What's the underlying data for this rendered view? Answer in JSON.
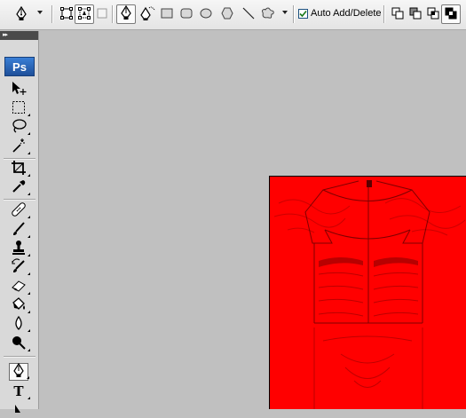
{
  "options_bar": {
    "current_tool_icon": "pen-tool-icon",
    "mode_buttons": [
      "shape-layers-icon",
      "paths-icon",
      "fill-pixels-icon"
    ],
    "tool_buttons": [
      "pen-icon",
      "freeform-pen-icon",
      "rectangle-icon",
      "rounded-rectangle-icon",
      "ellipse-icon",
      "polygon-icon",
      "line-icon",
      "custom-shape-icon"
    ],
    "auto_add_delete": {
      "label": "Auto Add/Delete",
      "checked": true
    },
    "path_ops": [
      "add-to-path-icon",
      "subtract-from-path-icon",
      "intersect-path-icon",
      "exclude-path-icon"
    ]
  },
  "toolbox": {
    "logo": "Ps",
    "tools": [
      "move-tool-icon",
      "marquee-tool-icon",
      "lasso-tool-icon",
      "magic-wand-tool-icon",
      "crop-tool-icon",
      "eyedropper-tool-icon",
      "healing-brush-tool-icon",
      "brush-tool-icon",
      "clone-stamp-tool-icon",
      "history-brush-tool-icon",
      "eraser-tool-icon",
      "paint-bucket-tool-icon",
      "blur-tool-icon",
      "dodge-tool-icon",
      "pen-tool-icon",
      "type-tool-icon",
      "path-selection-tool-icon"
    ],
    "type_tool_glyph": "T"
  },
  "document": {
    "fill_color": "#ff0000",
    "shade_color": "#8a0000"
  }
}
